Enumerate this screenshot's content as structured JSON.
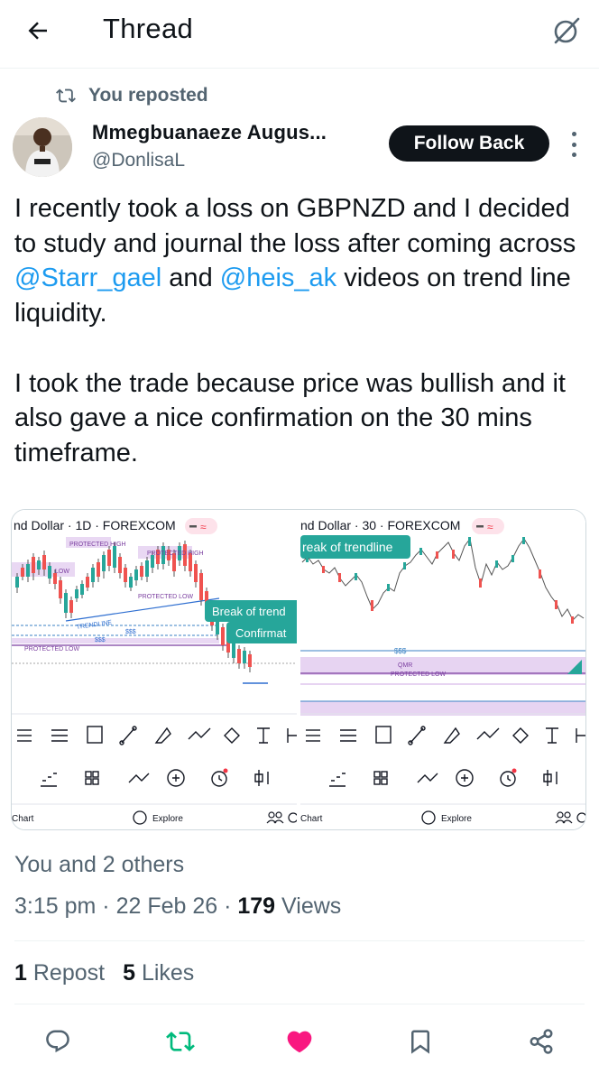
{
  "header": {
    "title": "Thread"
  },
  "repost": {
    "label": "You reposted"
  },
  "author": {
    "name": "Mmegbuanaeze Augus...",
    "handle": "@DonlisaL",
    "follow_label": "Follow Back"
  },
  "tweet": {
    "p1_a": "I recently took a loss on GBPNZD and I decided to study and journal the loss after coming across ",
    "mention1": "@Starr_gael",
    "p1_and": " and ",
    "mention2": "@heis_ak",
    "p1_b": " videos on trend line liquidity.",
    "p2": "I took the trade because price was bullish and it also gave a nice confirmation on the 30 mins timeframe."
  },
  "media": {
    "left": {
      "symbol": "nd Dollar · 1D · FOREXCOM",
      "labels": [
        "Break of trend",
        "Confirmat",
        "TRENDLINE",
        "$$$",
        "$$$",
        "PROTECTED LOW",
        "PROTECTED HIGH",
        "PROTECTED LOW",
        "PROTECTED HIGH",
        "LOW"
      ],
      "nav": [
        "Chart",
        "Explore"
      ]
    },
    "right": {
      "symbol": "nd Dollar · 30 · FOREXCOM",
      "labels": [
        "reak of trendline",
        "$$$",
        "QMR",
        "PROTECTED LOW"
      ],
      "nav": [
        "Chart",
        "Explore"
      ]
    }
  },
  "social": {
    "likers": "You and 2 others"
  },
  "meta": {
    "time": "3:15 pm",
    "date": "22 Feb 26",
    "views_count": "179",
    "views_label": "Views"
  },
  "stats": {
    "reposts_count": "1",
    "reposts_label": "Repost",
    "likes_count": "5",
    "likes_label": "Likes"
  },
  "colors": {
    "accent": "#1d9bf0",
    "repost_green": "#00ba7c",
    "like_pink": "#f91880",
    "teal_label": "#26a69a"
  }
}
